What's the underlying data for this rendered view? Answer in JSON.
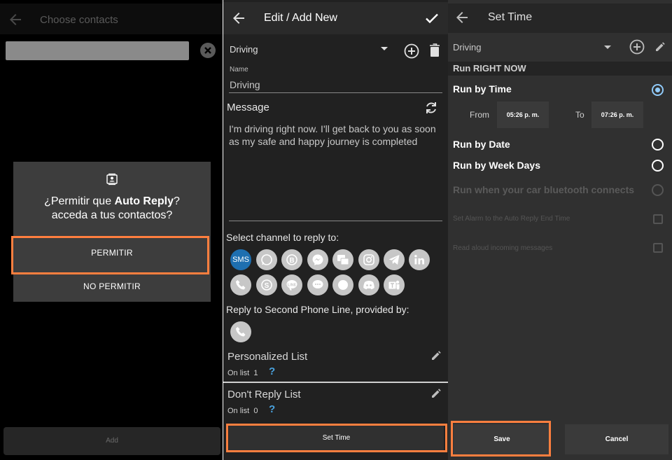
{
  "panel1": {
    "title": "Choose contacts",
    "dialog": {
      "line1_prefix": "¿Permitir que ",
      "line1_bold": "Auto Reply",
      "line2": "acceda a tus contactos?",
      "allow": "PERMITIR",
      "deny": "NO PERMITIR"
    },
    "add_button": "Add"
  },
  "panel2": {
    "title": "Edit / Add New",
    "profile": "Driving",
    "name_label": "Name",
    "name_value": "Driving",
    "message_label": "Message",
    "message_text": "I'm driving right now. I'll get back to you as soon as my safe and happy journey is completed",
    "select_channel": "Select channel to reply to:",
    "sms_label": "SMS",
    "second_line": "Reply to Second Phone Line, provided by:",
    "personalized_list": "Personalized List",
    "personalized_count_label": "On list",
    "personalized_count": "1",
    "dont_reply_list": "Don't Reply List",
    "dont_reply_count_label": "On list",
    "dont_reply_count": "0",
    "help": "?",
    "set_time_button": "Set Time"
  },
  "panel3": {
    "title": "Set Time",
    "profile": "Driving",
    "run_now": "Run RIGHT NOW",
    "run_by_time": "Run by Time",
    "from_label": "From",
    "from_value": "05:26 p. m.",
    "to_label": "To",
    "to_value": "07:26 p. m.",
    "run_by_date": "Run by Date",
    "run_by_week": "Run by Week Days",
    "run_bluetooth": "Run when your car bluetooth connects",
    "set_alarm": "Set Alarm to the Auto Reply End Time",
    "read_aloud": "Read aloud incoming messages",
    "save": "Save",
    "cancel": "Cancel"
  },
  "colors": {
    "highlight": "#ff7f3f",
    "radio_selected": "#90caf9",
    "sms_blue": "#1e6fb0",
    "link_blue": "#4aa3df"
  }
}
